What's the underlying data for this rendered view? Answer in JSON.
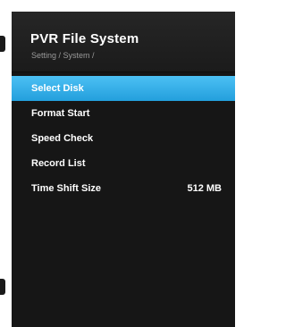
{
  "header": {
    "title": "PVR File System",
    "breadcrumb": "Setting / System /"
  },
  "menu": {
    "items": [
      {
        "label": "Select Disk",
        "value": "",
        "selected": true
      },
      {
        "label": "Format Start",
        "value": ""
      },
      {
        "label": "Speed Check",
        "value": ""
      },
      {
        "label": "Record List",
        "value": ""
      },
      {
        "label": "Time Shift Size",
        "value": "512 MB"
      }
    ]
  },
  "colors": {
    "highlight": "#2fa8e4",
    "panel_background": "#161616",
    "text": "#ffffff",
    "subtext": "#9a9a9a"
  }
}
